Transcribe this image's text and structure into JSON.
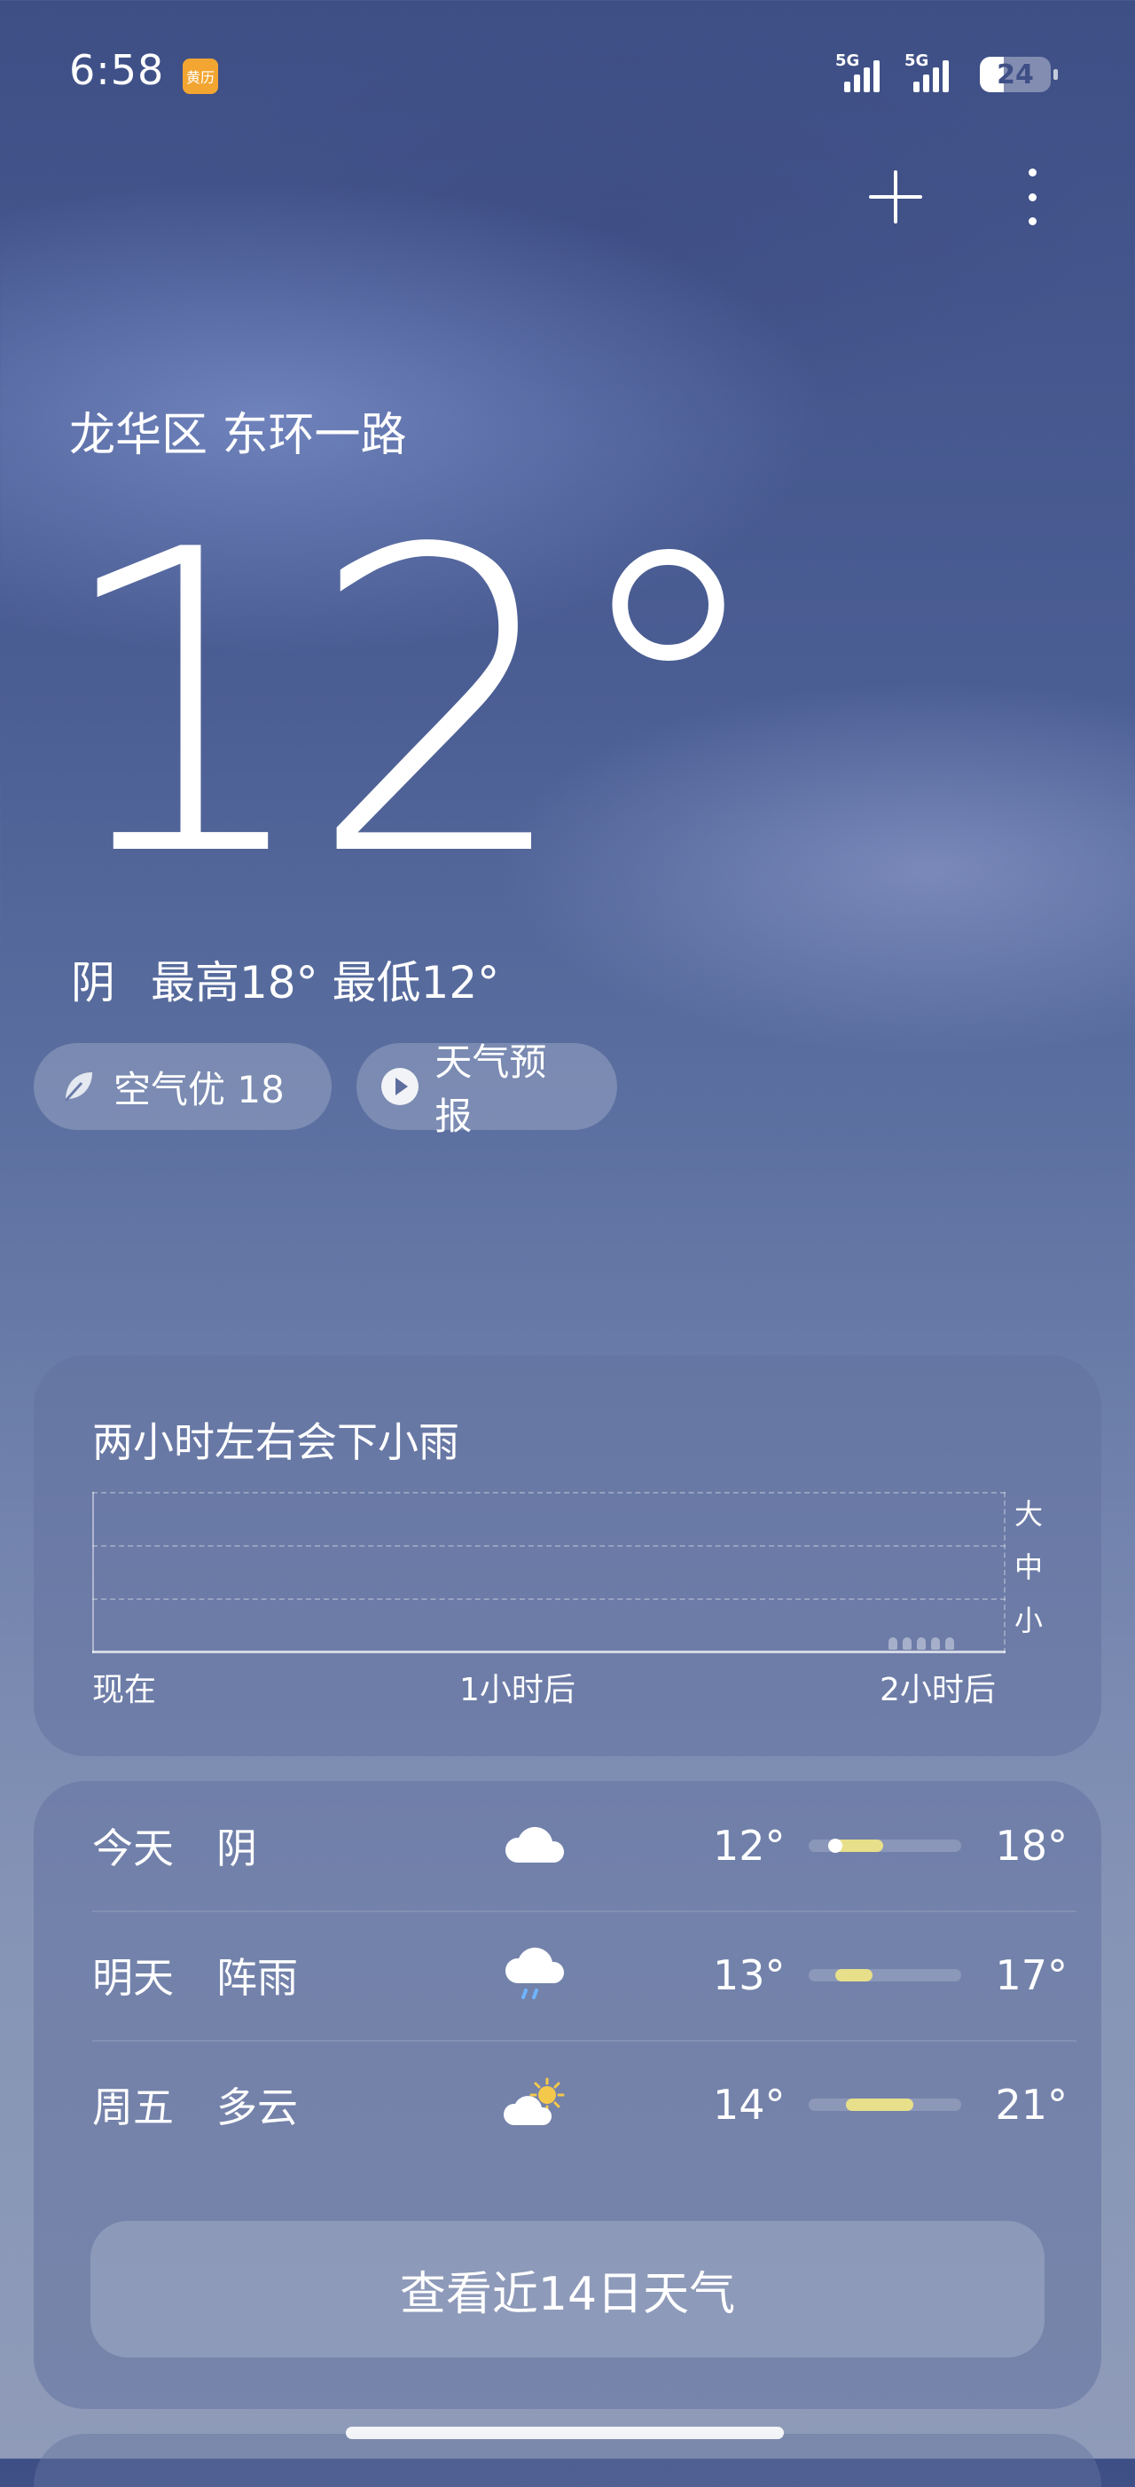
{
  "status_bar": {
    "time": "6:58",
    "calendar_badge": "黄历",
    "signal1_label": "5G",
    "signal2_label": "5G",
    "battery": "24"
  },
  "header": {
    "location": "龙华区 东环一路"
  },
  "current": {
    "temperature": "12°",
    "condition": "阴",
    "high_low": "最高18° 最低12°"
  },
  "chips": {
    "aqi_label": "空气优 18",
    "forecast_label": "天气预报"
  },
  "rain_forecast": {
    "title": "两小时左右会下小雨",
    "levels": [
      "大",
      "中",
      "小"
    ],
    "time_labels": [
      "现在",
      "1小时后",
      "2小时后"
    ]
  },
  "daily": {
    "rows": [
      {
        "day": "今天",
        "condition": "阴",
        "icon": "cloud-icon",
        "low": "12°",
        "high": "18°"
      },
      {
        "day": "明天",
        "condition": "阵雨",
        "icon": "rain-cloud-icon",
        "low": "13°",
        "high": "17°"
      },
      {
        "day": "周五",
        "condition": "多云",
        "icon": "partly-cloudy-icon",
        "low": "14°",
        "high": "21°"
      }
    ],
    "more_button": "查看近14日天气"
  },
  "colors": {
    "accent_bar": "#e8df8a",
    "calendar_badge": "#f3a531"
  }
}
